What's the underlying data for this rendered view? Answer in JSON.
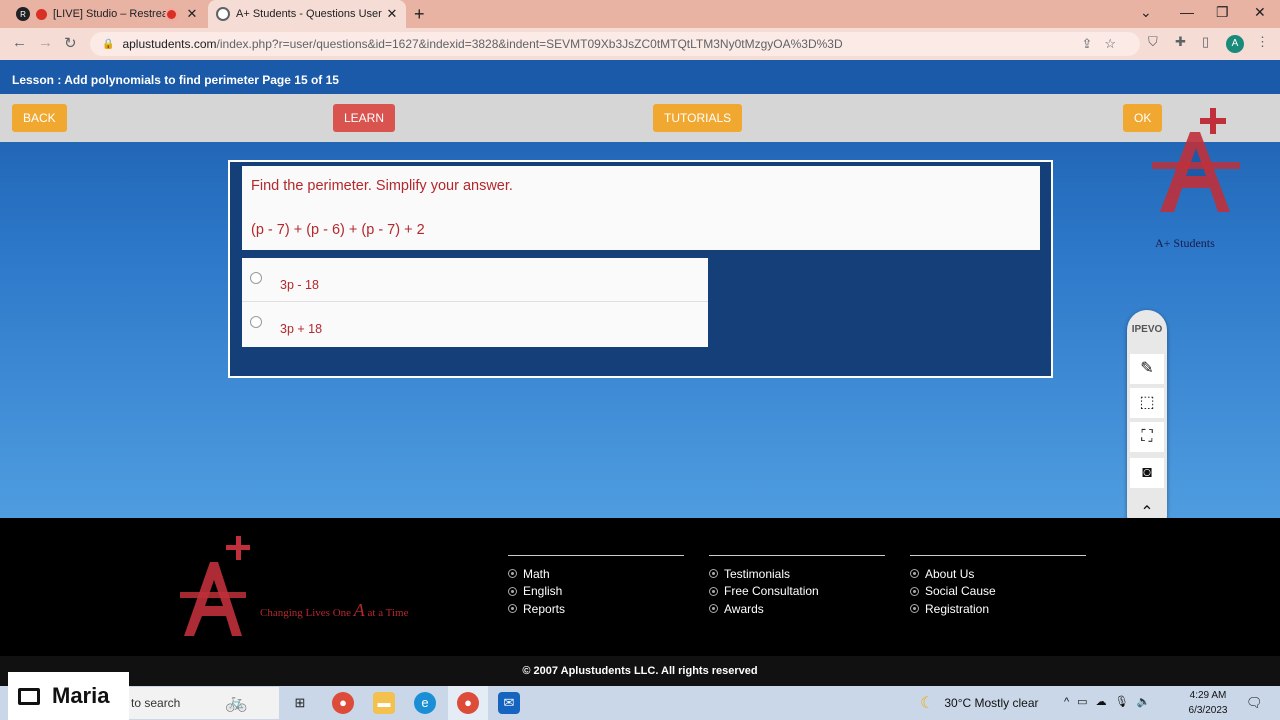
{
  "browser": {
    "tabs": [
      {
        "title": "[LIVE] Studio – Restream"
      },
      {
        "title": "A+ Students - Questions User"
      }
    ],
    "url_host": "aplustudents.com",
    "url_path": "/index.php?r=user/questions&id=1627&indexid=3828&indent=SEVMT09Xb3JsZC0tMTQtLTM3Ny0tMzgyOA%3D%3D",
    "profile_initial": "A"
  },
  "lesson": {
    "title": "Lesson : Add polynomials to find perimeter Page 15 of 15"
  },
  "toolbar": {
    "back_label": "BACK",
    "learn_label": "LEARN",
    "tutorials_label": "TUTORIALS",
    "ok_label": "OK"
  },
  "brand": {
    "name": "A+ Students",
    "logo_text": "A+",
    "tagline_pre": "Changing Lives One",
    "tagline_mark": "A",
    "tagline_post": "at a Time"
  },
  "question": {
    "prompt": "Find the perimeter. Simplify your answer.",
    "expression": "(p - 7) + (p - 6) + (p - 7) + 2",
    "options": [
      {
        "label": "3p - 18",
        "selected": false
      },
      {
        "label": "3p + 18",
        "selected": false
      }
    ]
  },
  "ipevo": {
    "brand": "IPEVO",
    "tools": [
      "pen-icon",
      "snapshot-icon",
      "region-icon",
      "camera-icon",
      "collapse-icon"
    ]
  },
  "footer": {
    "columns": [
      [
        "Math",
        "English",
        "Reports"
      ],
      [
        "Testimonials",
        "Free Consultation",
        "Awards"
      ],
      [
        "About Us",
        "Social Cause",
        "Registration"
      ]
    ],
    "copyright": "© 2007 Aplustudents LLC. All rights reserved"
  },
  "taskbar": {
    "user_name": "Maria",
    "search_placeholder": "to search",
    "weather": "30°C  Mostly clear",
    "time": "4:29 AM",
    "date": "6/3/2023"
  }
}
